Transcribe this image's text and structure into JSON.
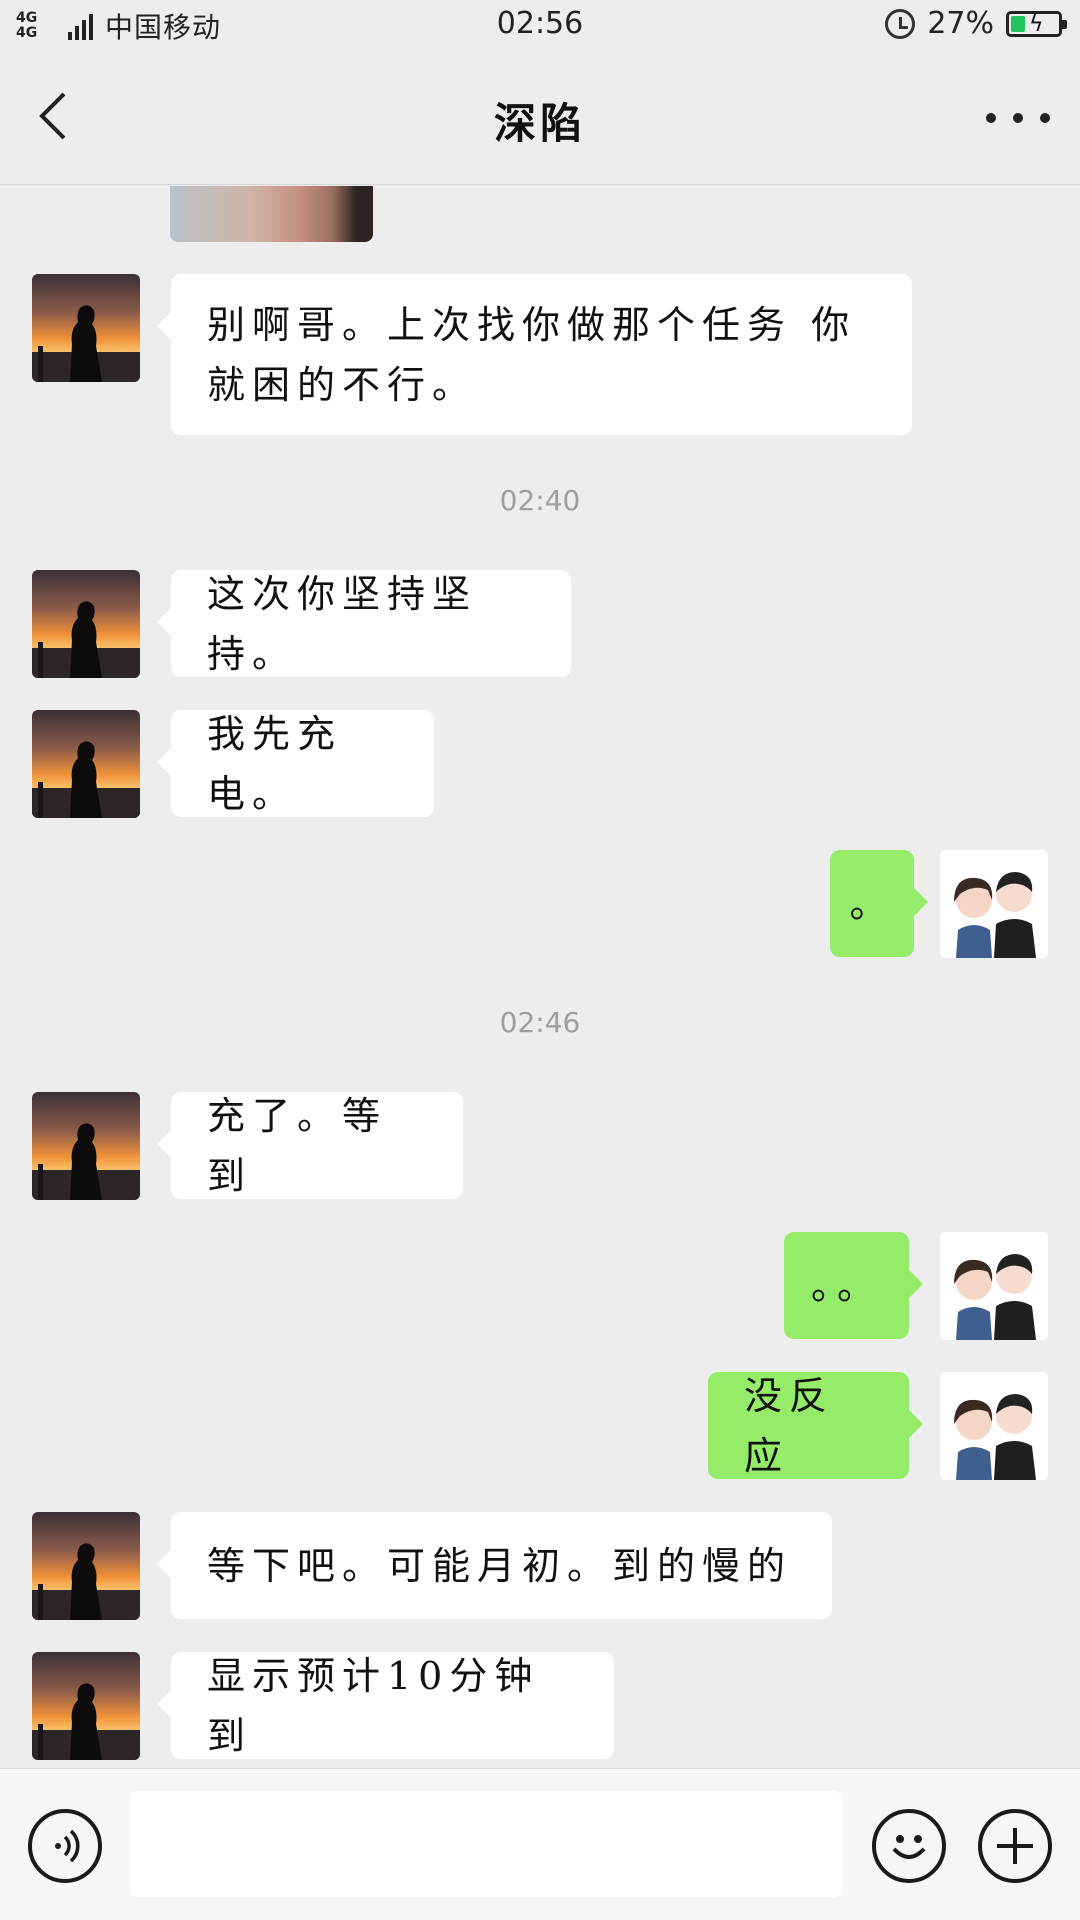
{
  "status_bar": {
    "network": "4G 4G",
    "carrier": "中国移动",
    "time": "02:56",
    "battery": "27%",
    "battery_level": 0.27
  },
  "header": {
    "title": "深陷",
    "back_icon": "chevron-left-icon",
    "more_icon": "more-dots-icon"
  },
  "messages": [
    {
      "type": "image",
      "from": "contact"
    },
    {
      "type": "text",
      "from": "contact",
      "lines": [
        "别啊哥。上次找你做那个任务 你",
        "就困的不行。"
      ]
    },
    {
      "type": "time",
      "text": "02:40"
    },
    {
      "type": "text",
      "from": "contact",
      "text": "这次你坚持坚持。"
    },
    {
      "type": "text",
      "from": "contact",
      "text": "我先充电。"
    },
    {
      "type": "text",
      "from": "me",
      "text": "。"
    },
    {
      "type": "time",
      "text": "02:46"
    },
    {
      "type": "text",
      "from": "contact",
      "text": "充了。等到"
    },
    {
      "type": "text",
      "from": "me",
      "text": "。。"
    },
    {
      "type": "text",
      "from": "me",
      "text": "没反应"
    },
    {
      "type": "text",
      "from": "contact",
      "text": "等下吧。可能月初。到的慢的"
    },
    {
      "type": "text",
      "from": "contact",
      "text": "显示预计10分钟到"
    }
  ],
  "input_bar": {
    "voice_icon": "voice-icon",
    "text_value": "",
    "emoji_icon": "emoji-icon",
    "plus_icon": "plus-icon"
  },
  "colors": {
    "background": "#ededed",
    "incoming_bubble": "#ffffff",
    "outgoing_bubble": "#95ec69",
    "timestamp": "#9e9e9e",
    "battery_fill": "#21c45d"
  }
}
